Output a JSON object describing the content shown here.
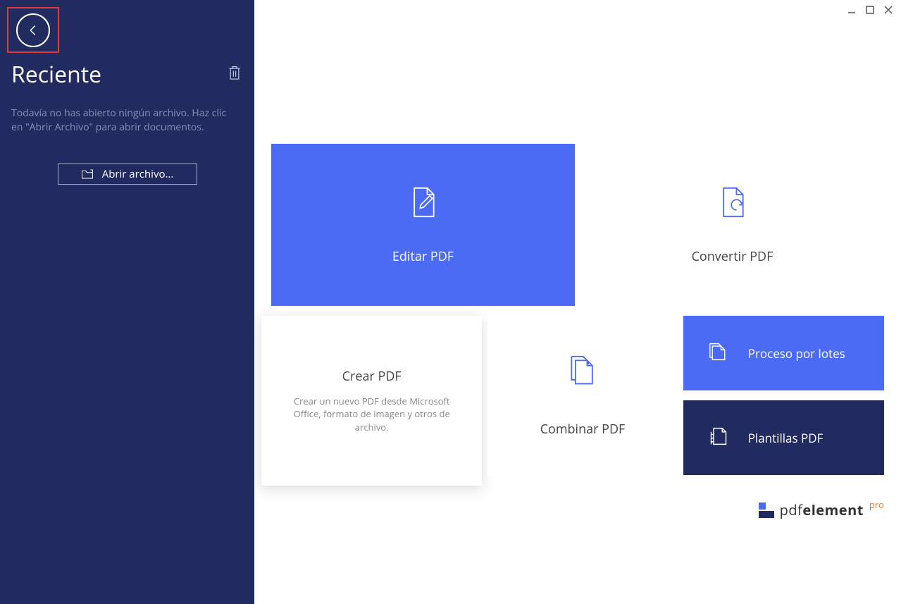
{
  "sidebar": {
    "title": "Reciente",
    "empty_message": "Todavía no has abierto ningún archivo. Haz clic en \"Abrir Archivo\" para abrir documentos.",
    "open_button": "Abrir archivo..."
  },
  "tiles": {
    "edit": "Editar PDF",
    "convert": "Convertir PDF",
    "create": {
      "label": "Crear PDF",
      "desc": "Crear un nuevo PDF desde Microsoft Office, formato de imagen y otros de archivo."
    },
    "combine": "Combinar PDF",
    "batch": "Proceso por lotes",
    "templates": "Plantillas PDF"
  },
  "brand": {
    "name_light": "pdf",
    "name_bold": "element",
    "badge": "pro"
  }
}
